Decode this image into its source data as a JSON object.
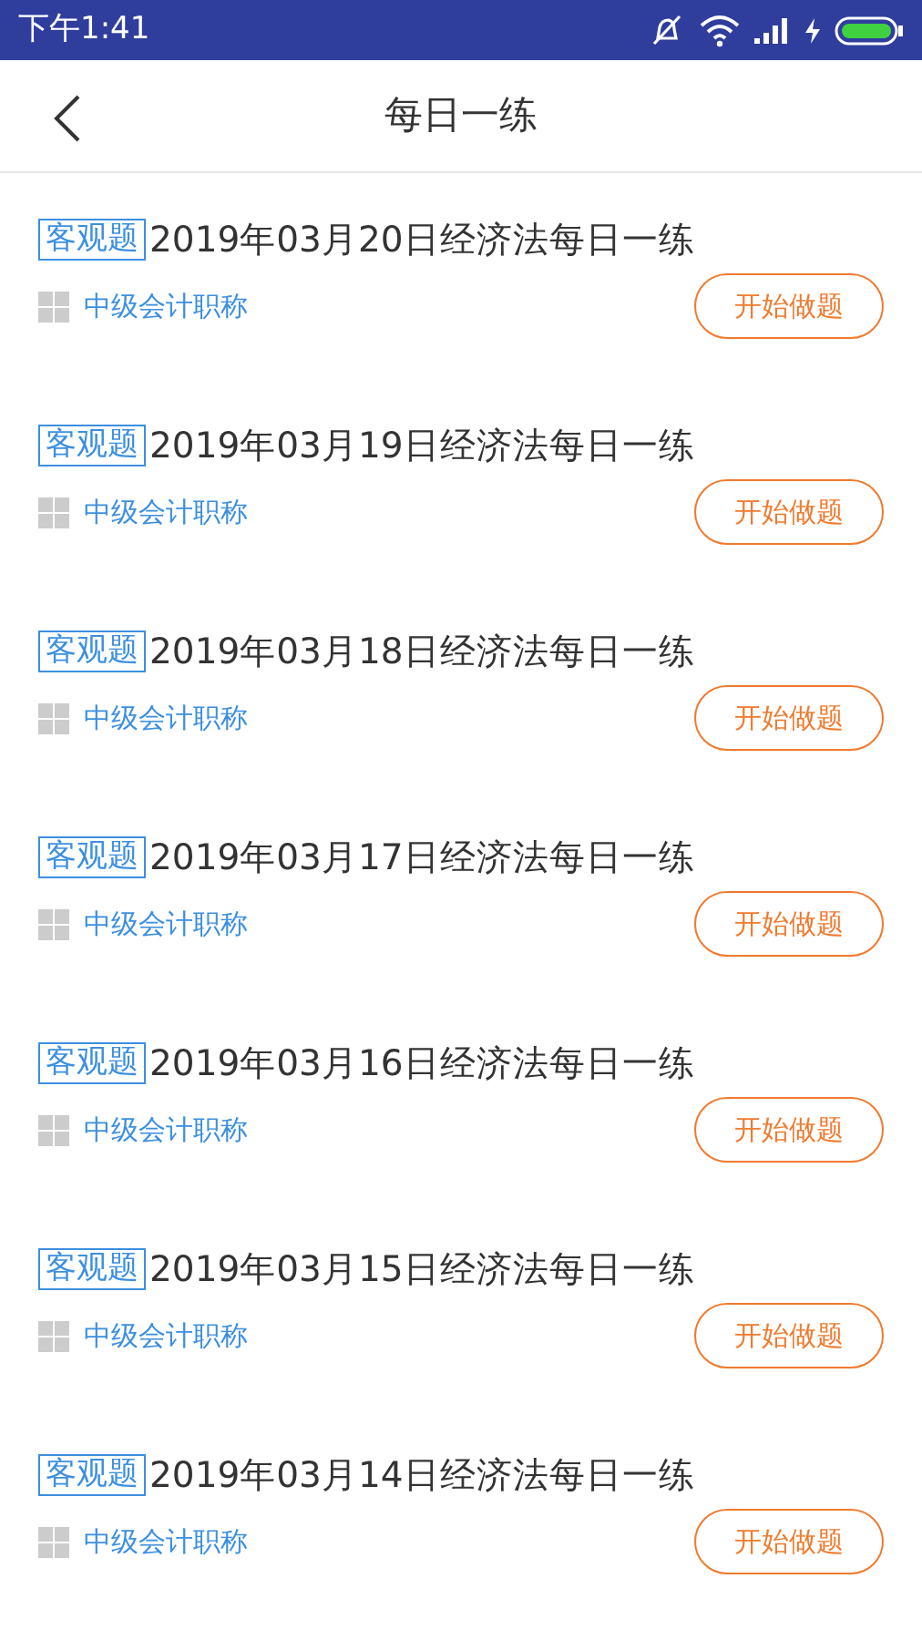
{
  "status_bar": {
    "time": "下午1:41"
  },
  "header": {
    "title": "每日一练"
  },
  "items": [
    {
      "tag": "客观题",
      "title": "2019年03月20日经济法每日一练",
      "category": "中级会计职称",
      "button": "开始做题"
    },
    {
      "tag": "客观题",
      "title": "2019年03月19日经济法每日一练",
      "category": "中级会计职称",
      "button": "开始做题"
    },
    {
      "tag": "客观题",
      "title": "2019年03月18日经济法每日一练",
      "category": "中级会计职称",
      "button": "开始做题"
    },
    {
      "tag": "客观题",
      "title": "2019年03月17日经济法每日一练",
      "category": "中级会计职称",
      "button": "开始做题"
    },
    {
      "tag": "客观题",
      "title": "2019年03月16日经济法每日一练",
      "category": "中级会计职称",
      "button": "开始做题"
    },
    {
      "tag": "客观题",
      "title": "2019年03月15日经济法每日一练",
      "category": "中级会计职称",
      "button": "开始做题"
    },
    {
      "tag": "客观题",
      "title": "2019年03月14日经济法每日一练",
      "category": "中级会计职称",
      "button": "开始做题"
    }
  ]
}
